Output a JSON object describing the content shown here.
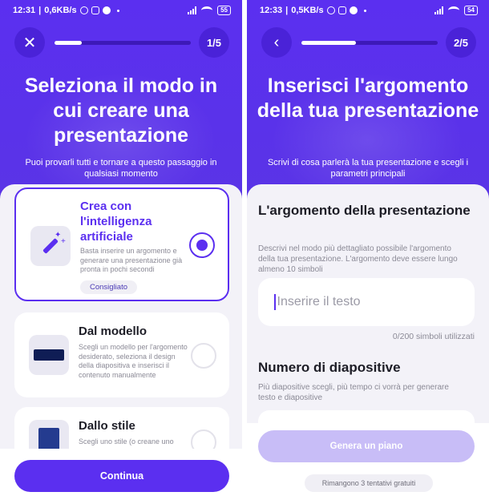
{
  "status_left": {
    "time": "12:31",
    "speed": "0,6KB/s",
    "battery": "55"
  },
  "status_right": {
    "time": "12:33",
    "speed": "0,5KB/s",
    "battery": "54"
  },
  "colors": {
    "accent": "#5b2ff0",
    "accent_light": "#c8bdf7",
    "background": "#f3f2f8"
  },
  "left": {
    "step": "1/5",
    "progress": 0.2,
    "title": "Seleziona il modo in cui creare una presentazione",
    "subtitle": "Puoi provarli tutti e tornare a questo passaggio in qualsiasi momento",
    "options": [
      {
        "title": "Crea con l'intelligenza artificiale",
        "description": "Basta inserire un argomento e generare una presentazione già pronta in pochi secondi",
        "badge": "Consigliato",
        "selected": true,
        "icon": "magic-wand-icon"
      },
      {
        "title": "Dal modello",
        "description": "Scegli un modello per l'argomento desiderato, seleziona il design della diapositiva e inserisci il contenuto manualmente",
        "selected": false,
        "icon": "template-icon"
      },
      {
        "title": "Dallo stile",
        "description": "Scegli uno stile (o creane uno",
        "selected": false,
        "icon": "style-icon"
      }
    ],
    "continue_label": "Continua"
  },
  "right": {
    "step": "2/5",
    "progress": 0.4,
    "title": "Inserisci l'argomento della tua presentazione",
    "subtitle": "Scrivi di cosa parlerà la tua presentazione e scegli i parametri principali",
    "topic_heading": "L'argomento della presentazione",
    "topic_desc": "Descrivi nel modo più dettagliato possibile l'argomento della tua presentazione. L'argomento deve essere lungo almeno 10 simboli",
    "input_placeholder": "Inserire il testo",
    "counter": "0/200 simboli utilizzati",
    "slides_heading": "Numero di diapositive",
    "slides_desc": "Più diapositive scegli, più tempo ci vorrà per generare testo e diapositive",
    "generate_label": "Genera un piano",
    "tries_label": "Rimangono 3 tentativi gratuiti"
  }
}
